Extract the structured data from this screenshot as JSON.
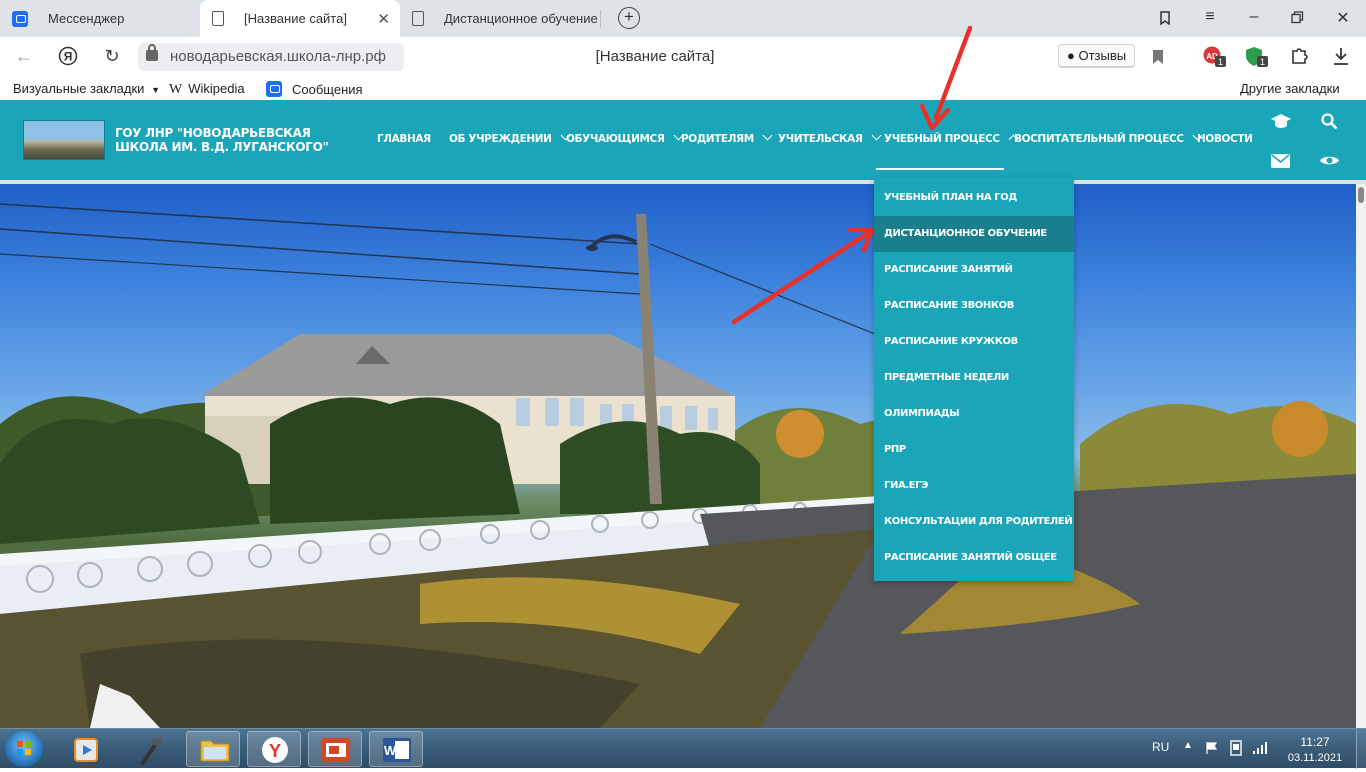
{
  "browser": {
    "tabs": [
      {
        "label": "Мессенджер",
        "active": false
      },
      {
        "label": "[Название сайта]",
        "active": true
      },
      {
        "label": "Дистанционное обучение",
        "active": false
      }
    ],
    "url": "новодарьевская.школа-лнр.рф",
    "page_title": "[Название сайта]",
    "reviews_label": "Отзывы",
    "badges": {
      "adblock": "1",
      "shield": "1"
    },
    "bookmarks": [
      "Визуальные закладки",
      "Wikipedia",
      "Сообщения"
    ],
    "other_bookmarks": "Другие закладки"
  },
  "site": {
    "school_name": "ГОУ ЛНР \"НОВОДАРЬЕВСКАЯ ШКОЛА ИМ. В.Д. ЛУГАНСКОГО\"",
    "menu": [
      {
        "label": "ГЛАВНАЯ",
        "has_submenu": false
      },
      {
        "label": "ОБ УЧРЕЖДЕНИИ",
        "has_submenu": true
      },
      {
        "label": "ОБУЧАЮЩИМСЯ",
        "has_submenu": true
      },
      {
        "label": "РОДИТЕЛЯМ",
        "has_submenu": true
      },
      {
        "label": "УЧИТЕЛЬСКАЯ",
        "has_submenu": true
      },
      {
        "label": "УЧЕБНЫЙ ПРОЦЕСС",
        "has_submenu": true,
        "expanded": true
      },
      {
        "label": "ВОСПИТАТЕЛЬНЫЙ ПРОЦЕСС",
        "has_submenu": true
      },
      {
        "label": "НОВОСТИ",
        "has_submenu": false
      }
    ],
    "dropdown": [
      "УЧЕБНЫЙ ПЛАН НА ГОД",
      "ДИСТАНЦИОННОЕ ОБУЧЕНИЕ",
      "РАСПИСАНИЕ ЗАНЯТИЙ",
      "РАСПИСАНИЕ ЗВОНКОВ",
      "РАСПИСАНИЕ КРУЖКОВ",
      "ПРЕДМЕТНЫЕ НЕДЕЛИ",
      "ОЛИМПИАДЫ",
      "РПР",
      "ГИА.ЕГЭ",
      "КОНСУЛЬТАЦИИ ДЛЯ РОДИТЕЛЕЙ",
      "РАСПИСАНИЕ ЗАНЯТИЙ ОБЩЕЕ"
    ],
    "highlighted_item": "ДИСТАНЦИОННОЕ ОБУЧЕНИЕ"
  },
  "taskbar": {
    "language": "RU",
    "time": "11:27",
    "date": "03.11.2021"
  },
  "colors": {
    "site_teal": "#1aa5b8",
    "dropdown_highlight": "#1a7f8c",
    "annotation_arrow": "#e8312a"
  }
}
